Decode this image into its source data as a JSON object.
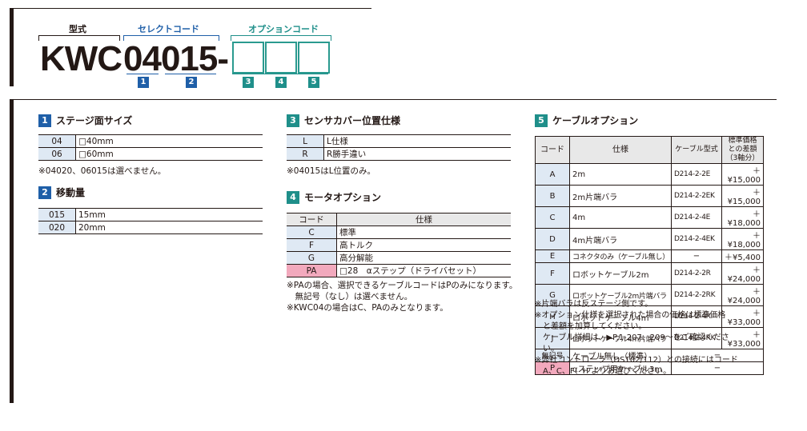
{
  "header": {
    "label_type": "型式",
    "label_select": "セレクトコード",
    "label_option": "オプションコード",
    "model_prefix": "KWC",
    "model_select": "04015-",
    "nums": [
      "1",
      "2",
      "3",
      "4",
      "5"
    ]
  },
  "sec1": {
    "num": "1",
    "title": "ステージ面サイズ",
    "rows": [
      {
        "code": "04",
        "value": "□40mm"
      },
      {
        "code": "06",
        "value": "□60mm"
      }
    ],
    "note": "※04020、06015は選べません。"
  },
  "sec2": {
    "num": "2",
    "title": "移動量",
    "rows": [
      {
        "code": "015",
        "value": "15mm"
      },
      {
        "code": "020",
        "value": "20mm"
      }
    ]
  },
  "sec3": {
    "num": "3",
    "title": "センサカバー位置仕様",
    "rows": [
      {
        "code": "L",
        "value": "L仕様"
      },
      {
        "code": "R",
        "value": "R勝手違い"
      }
    ],
    "note": "※04015はL位置のみ。"
  },
  "sec4": {
    "num": "4",
    "title": "モータオプション",
    "head_code": "コード",
    "head_spec": "仕様",
    "rows": [
      {
        "code": "C",
        "value": "標準"
      },
      {
        "code": "F",
        "value": "高トルク"
      },
      {
        "code": "G",
        "value": "高分解能"
      },
      {
        "code": "PA",
        "value": "□28　αステップ（ドライバセット）"
      }
    ],
    "note": "※PAの場合、選択できるケーブルコードはPのみになります。\n　無記号（なし）は選べません。\n※KWC04の場合はC、PAのみとなります。"
  },
  "sec5": {
    "num": "5",
    "title": "ケーブルオプション",
    "head_code": "コード",
    "head_spec": "仕様",
    "head_model": "ケーブル型式",
    "head_price": "標準価格との差額（3軸分）",
    "rows": [
      {
        "code": "A",
        "spec": "2m",
        "model": "D214-2-2E",
        "price": "＋¥15,000"
      },
      {
        "code": "B",
        "spec": "2m片端バラ",
        "model": "D214-2-2EK",
        "price": "＋¥15,000"
      },
      {
        "code": "C",
        "spec": "4m",
        "model": "D214-2-4E",
        "price": "＋¥18,000"
      },
      {
        "code": "D",
        "spec": "4m片端バラ",
        "model": "D214-2-4EK",
        "price": "＋¥18,000"
      },
      {
        "code": "E",
        "spec": "コネクタのみ（ケーブル無し）",
        "model": "−",
        "price": "＋¥5,400"
      },
      {
        "code": "F",
        "spec": "ロボットケーブル2m",
        "model": "D214-2-2R",
        "price": "＋¥24,000"
      },
      {
        "code": "G",
        "spec": "ロボットケーブル2m片端バラ",
        "model": "D214-2-2RK",
        "price": "＋¥24,000"
      },
      {
        "code": "H",
        "spec": "ロボットケーブル4m",
        "model": "D214-2-4R",
        "price": "＋¥33,000"
      },
      {
        "code": "J",
        "spec": "ロボットケーブル4m片端バラ",
        "model": "D214-2-4RK",
        "price": "＋¥33,000"
      },
      {
        "code": "無記号",
        "spec": "ケーブル無し（標準）",
        "model": "−",
        "price": ""
      },
      {
        "code": "P",
        "spec": "αステップ用ケーブル3m",
        "model": "−",
        "price": ""
      }
    ],
    "note": "※片端バラは反ステージ側です。\n※オプション仕様を選択された場合の価格は標準価格\n　と差額を加算してください。\n　ケーブル詳細は、▶P.1-207、209〜をご確認くださ\n　い。\n※弊社コントローラ（DS102/112）との接続にはコード\n　A、C、F、H よりお選びください。"
  },
  "colors": {
    "blue": "#1f5fa8",
    "teal": "#1f8f8a",
    "code_bg": "#dfe9f4",
    "pink": "#f2a9bd"
  }
}
